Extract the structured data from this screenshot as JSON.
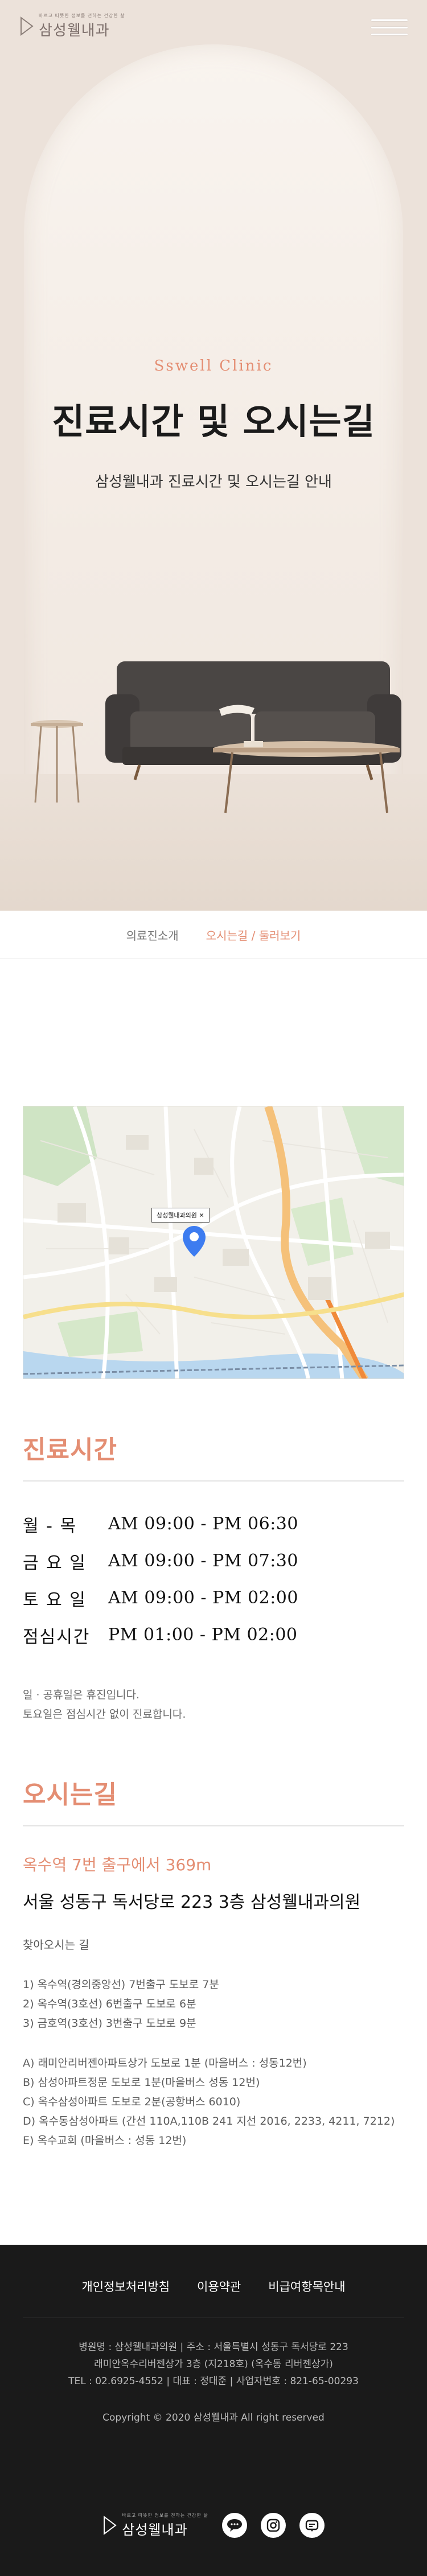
{
  "header": {
    "logo_sub": "바르고 따뜻한 정보를 전하는 건강한 삶",
    "logo_name": "삼성웰내과"
  },
  "hero": {
    "en_title": "Sswell Clinic",
    "title": "진료시간 및 오시는길",
    "desc": "삼성웰내과 진료시간 및 오시는길 안내"
  },
  "breadcrumb": {
    "home": "의료진소개",
    "current": "오시는길 / 둘러보기"
  },
  "map": {
    "label": "삼성웰내과의원  ✕"
  },
  "hours": {
    "title": "진료시간",
    "rows": [
      {
        "day": "월 - 목",
        "time": "AM 09:00 - PM 06:30"
      },
      {
        "day": "금 요 일",
        "time": "AM 09:00 - PM 07:30"
      },
      {
        "day": "토 요 일",
        "time": "AM 09:00 - PM 02:00"
      },
      {
        "day": "점심시간",
        "time": "PM 01:00 - PM 02:00"
      }
    ],
    "notes": [
      "일 · 공휴일은 휴진입니다.",
      "토요일은 점심시간 없이 진료합니다."
    ]
  },
  "directions": {
    "title": "오시는길",
    "subtitle": "옥수역 7번 출구에서 369m",
    "address": "서울 성동구 독서당로 223 3층 삼성웰내과의원",
    "label": "찾아오시는 길",
    "subway": [
      "1) 옥수역(경의중앙선) 7번출구 도보로 7분",
      "2) 옥수역(3호선) 6번출구 도보로 6분",
      "3) 금호역(3호선) 3번출구 도보로 9분"
    ],
    "bus": [
      "A) 래미안리버젠아파트상가 도보로 1분 (마을버스 : 성동12번)",
      "B) 삼성아파트정문 도보로 1분(마을버스 성동 12번)",
      "C) 옥수삼성아파트 도보로 2분(공항버스 6010)",
      "D) 옥수동삼성아파트 (간선 110A,110B 241 지선 2016, 2233, 4211, 7212)",
      "E) 옥수교회 (마을버스 : 성동 12번)"
    ]
  },
  "footer": {
    "links": [
      "개인정보처리방침",
      "이용약관",
      "비급여항목안내"
    ],
    "info": [
      "병원명 : 삼성웰내과의원   |   주소 : 서울특별시 성동구 독서당로 223",
      "래미안옥수리버젠상가 3층 (지218호) (옥수동 리버젠상가)",
      "TEL : 02.6925-4552   |   대표 : 정대준   |   사업자번호 : 821-65-00293"
    ],
    "copyright": "Copyright © 2020 삼성웰내과 All right reserved",
    "logo_sub": "바르고 따뜻한 정보를 전하는 건강한 삶",
    "logo_name": "삼성웰내과"
  }
}
